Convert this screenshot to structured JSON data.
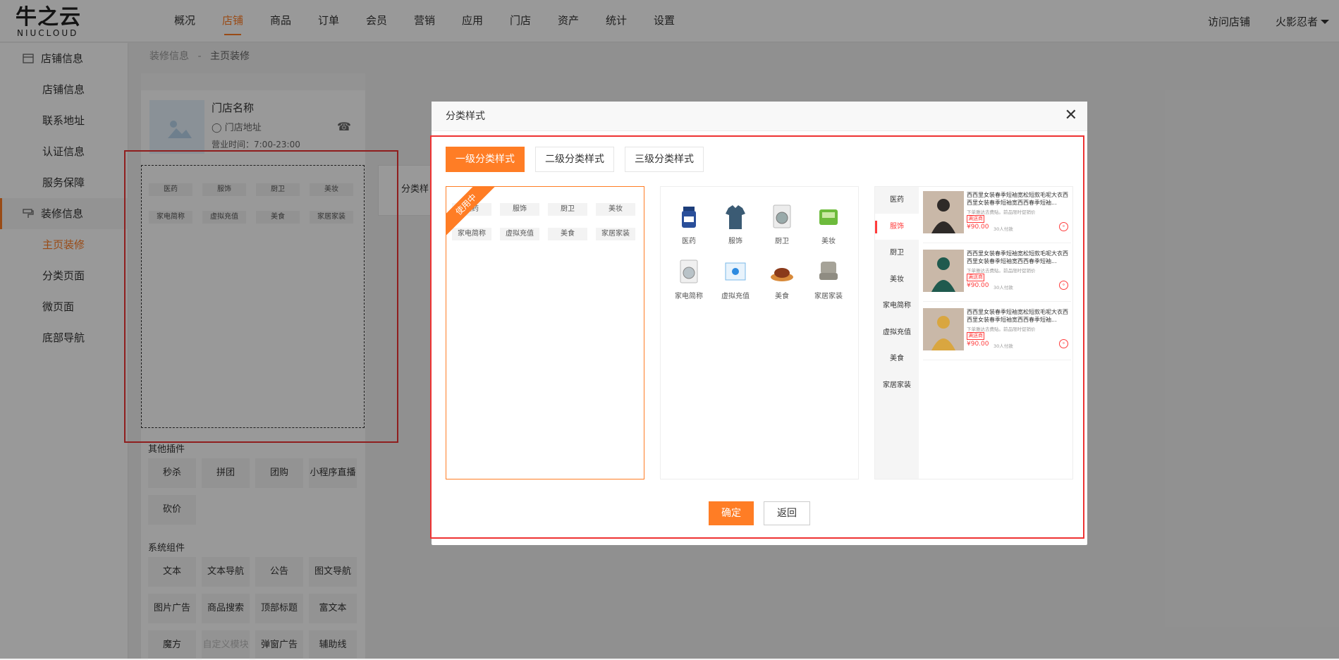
{
  "logo": {
    "big": "牛之云",
    "small": "NIUCLOUD"
  },
  "nav": {
    "items": [
      "概况",
      "店铺",
      "商品",
      "订单",
      "会员",
      "营销",
      "应用",
      "门店",
      "资产",
      "统计",
      "设置"
    ],
    "active": "店铺",
    "visit_store": "访问店铺",
    "user": "火影忍者"
  },
  "sidebar": {
    "group1": "店铺信息",
    "items1": [
      "店铺信息",
      "联系地址",
      "认证信息",
      "服务保障"
    ],
    "group2": "装修信息",
    "items2": [
      "主页装修",
      "分类页面",
      "微页面",
      "底部导航"
    ],
    "active": "主页装修"
  },
  "breadcrumb": {
    "parent": "装修信息",
    "sep": "-",
    "current": "主页装修"
  },
  "editor": {
    "store_name": "门店名称",
    "store_address": "门店地址",
    "store_hours": "营业时间：7:00-23:00",
    "categories": [
      "医药",
      "服饰",
      "厨卫",
      "美妆",
      "家电简称",
      "虚拟充值",
      "美食",
      "家居家装"
    ],
    "side_tab": "分类样",
    "other_plugins_title": "其他插件",
    "other_plugins": [
      "秒杀",
      "拼团",
      "团购",
      "小程序直播",
      "砍价"
    ],
    "system_title": "系统组件",
    "system_components": [
      "文本",
      "文本导航",
      "公告",
      "图文导航",
      "图片广告",
      "商品搜索",
      "顶部标题",
      "富文本",
      "魔方",
      "自定义模块",
      "弹窗广告",
      "辅助线"
    ]
  },
  "modal": {
    "title": "分类样式",
    "tabs": [
      "一级分类样式",
      "二级分类样式",
      "三级分类样式"
    ],
    "active_tab": "一级分类样式",
    "in_use": "使用中",
    "categories": [
      "医药",
      "服饰",
      "厨卫",
      "美妆",
      "家电简称",
      "虚拟充值",
      "美食",
      "家居家装"
    ],
    "level3": {
      "active_category": "服饰",
      "product": {
        "name": "西西里女装春季短袖宽松短款毛呢大衣西西里女装春季短袖宽西西春季短袖...",
        "desc": "下单雅达去费贴。前品限时促销价",
        "tag": "满送商",
        "price": "¥90.00",
        "sold": "30人付款"
      },
      "product_count": 3
    },
    "confirm": "确定",
    "back": "返回"
  },
  "colors": {
    "accent": "#ff7d25",
    "red": "#ff3c3c",
    "highlight": "#e33333"
  }
}
